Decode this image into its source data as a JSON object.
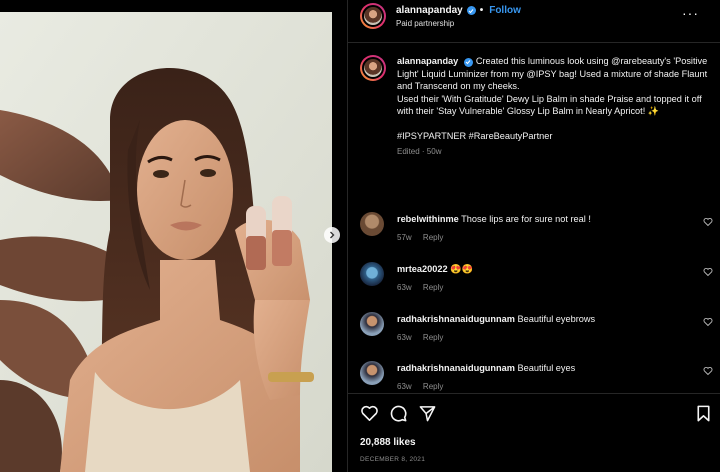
{
  "post": {
    "username": "alannapanday",
    "follow_label": "Follow",
    "dot": "•",
    "subtitle": "Paid partnership",
    "more_label": "···"
  },
  "caption": {
    "username": "alannapanday",
    "line1": "Created this luminous look using @rarebeauty's 'Positive Light' Liquid Luminizer from my @IPSY bag! Used a mixture of shade Flaunt and Transcend on my cheeks.",
    "line2": "Used their 'With Gratitude' Dewy Lip Balm in shade Praise and topped it off with their 'Stay Vulnerable' Glossy Lip Balm in Nearly Apricot! ✨",
    "hashtags": "#IPSYPARTNER #RareBeautyPartner",
    "meta": "Edited · 50w"
  },
  "comments": [
    {
      "username": "rebelwithinme",
      "text": "Those lips are for sure not real !",
      "age": "57w",
      "reply": "Reply"
    },
    {
      "username": "mrtea20022",
      "text": "😍😍",
      "age": "63w",
      "reply": "Reply"
    },
    {
      "username": "radhakrishnanaidugunnam",
      "text": "Beautiful eyebrows",
      "age": "63w",
      "reply": "Reply"
    },
    {
      "username": "radhakrishnanaidugunnam",
      "text": "Beautiful eyes",
      "age": "63w",
      "reply": "Reply"
    }
  ],
  "footer": {
    "likes": "20,888 likes",
    "date": "DECEMBER 8, 2021"
  },
  "colors": {
    "background": "#000000",
    "accent": "#3897f0",
    "muted": "#8e8e8e",
    "divider": "#262626"
  },
  "icons": [
    "verified-badge-icon",
    "more-options-icon",
    "heart-icon",
    "comment-icon",
    "share-icon",
    "bookmark-icon",
    "carousel-next-icon"
  ]
}
